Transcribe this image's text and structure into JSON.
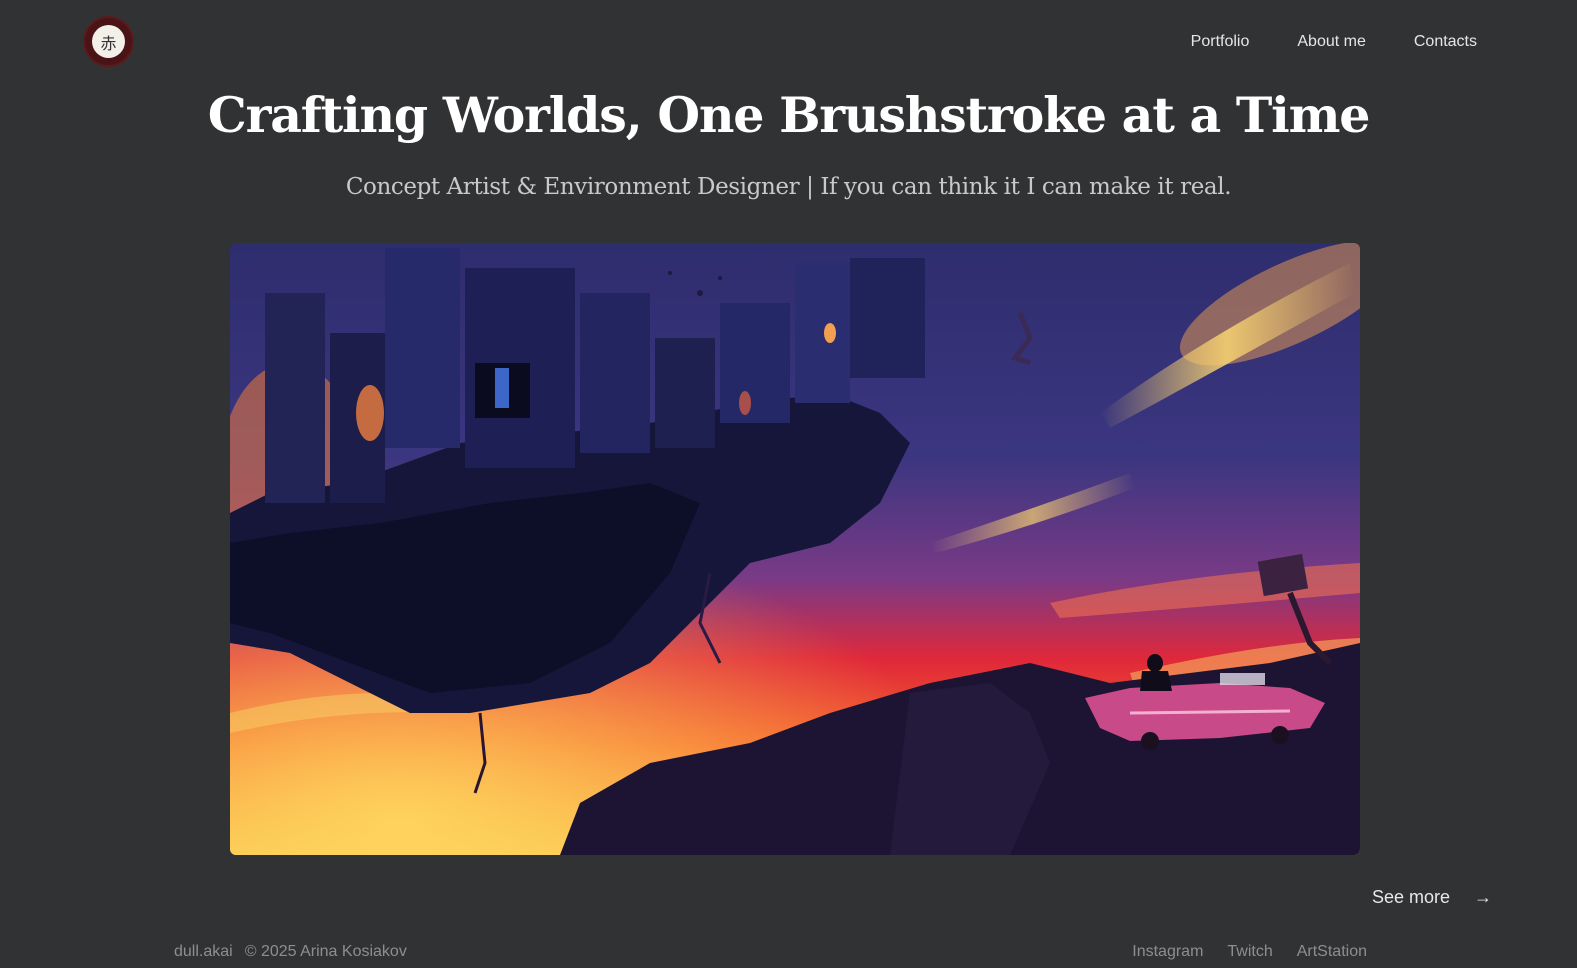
{
  "logo": {
    "glyph": "赤",
    "icon": "logo-seal-icon"
  },
  "nav": {
    "portfolio": "Portfolio",
    "about": "About me",
    "contacts": "Contacts"
  },
  "hero": {
    "title": "Crafting Worlds, One Brushstroke at a Time",
    "subtitle": "Concept Artist & Environment Designer | If you can think it I can make it real."
  },
  "artwork": {
    "alt": "Painting of a floating ruined city island above a fiery sunset sky, a figure sitting on a pink vintage car on a cliff"
  },
  "see_more": {
    "label": "See more",
    "arrow": "→"
  },
  "footer": {
    "handle": "dull.akai",
    "copyright": "© 2025 Arina Kosiakov",
    "links": {
      "instagram": "Instagram",
      "twitch": "Twitch",
      "artstation": "ArtStation"
    }
  },
  "colors": {
    "background": "#313234",
    "text": "#ffffff",
    "muted": "#8e8e90"
  }
}
